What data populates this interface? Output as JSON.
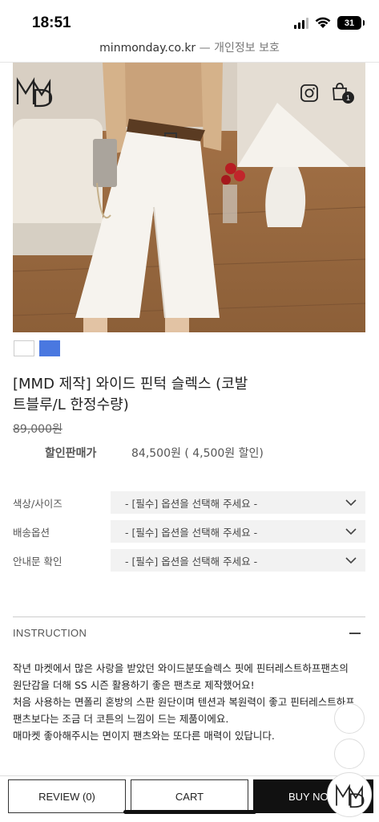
{
  "status": {
    "time": "18:51",
    "battery": "31"
  },
  "browser": {
    "domain": "minmonday.co.kr",
    "separator": "—",
    "privacy_label": "개인정보 보호"
  },
  "brand": {
    "logo": "MMD"
  },
  "header": {
    "cart_count": "1"
  },
  "swatches": [
    {
      "color": "#ffffff"
    },
    {
      "color": "#4a78e0"
    }
  ],
  "product": {
    "title": "[MMD 제작] 와이드 핀턱 슬렉스 (코발트블루/L 한정수량)",
    "original_price": "89,000원",
    "sale_label": "할인판매가",
    "sale_price": "84,500원 ( 4,500원 할인)"
  },
  "options": [
    {
      "label": "색상/사이즈",
      "placeholder": "- [필수] 옵션을 선택해 주세요 -"
    },
    {
      "label": "배송옵션",
      "placeholder": "- [필수] 옵션을 선택해 주세요 -"
    },
    {
      "label": "안내문 확인",
      "placeholder": "- [필수] 옵션을 선택해 주세요 -"
    }
  ],
  "instruction": {
    "title": "INSTRUCTION",
    "lines": [
      "작년 마켓에서 많은 사랑을 받았던 와이드분또슬렉스 핏에 핀터레스트하프팬츠의",
      "원단감을 더해 SS 시즌 활용하기 좋은 팬츠로 제작했어요!",
      "처음 사용하는 면폴리 혼방의 스판 원단이며 텐션과 복원력이 좋고 핀터레스트하프",
      "팬츠보다는 조금 더 코튼의 느낌이 드는 제품이에요.",
      "매마켓 좋아해주시는 면이지 팬츠와는 또다른 매력이 있답니다."
    ]
  },
  "actions": {
    "review": "REVIEW (0)",
    "cart": "CART",
    "buy": "BUY NOW"
  }
}
